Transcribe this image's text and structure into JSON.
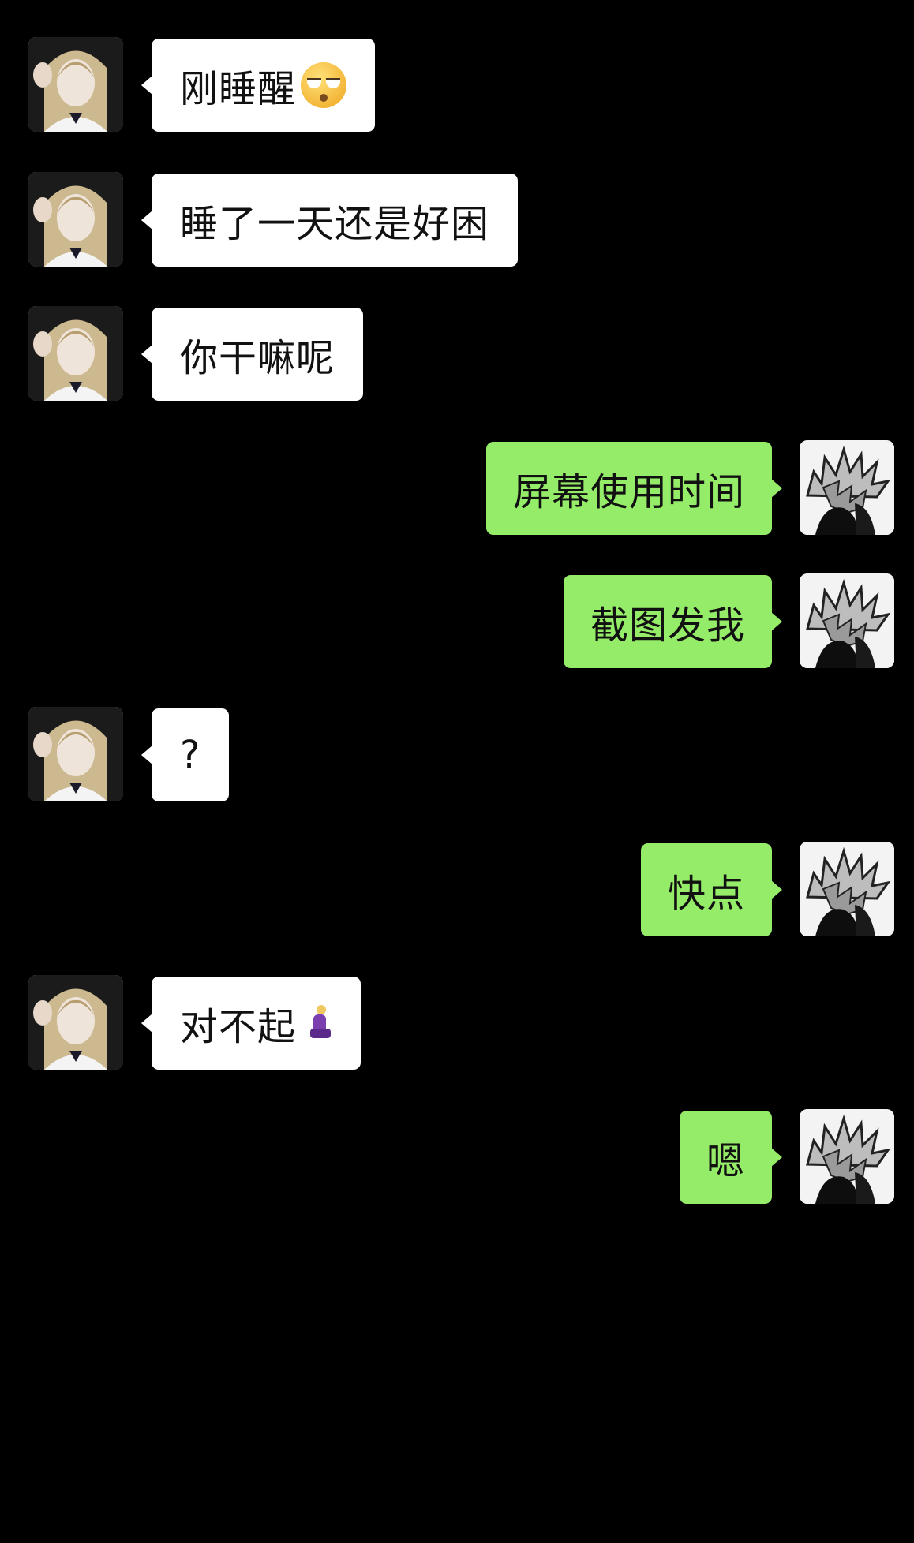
{
  "messages": [
    {
      "side": "left",
      "text": "刚睡醒",
      "emoji": "face-with-rolling-eyes-emoji"
    },
    {
      "side": "left",
      "text": "睡了一天还是好困"
    },
    {
      "side": "left",
      "text": "你干嘛呢"
    },
    {
      "side": "right",
      "text": "屏幕使用时间"
    },
    {
      "side": "right",
      "text": "截图发我"
    },
    {
      "side": "left",
      "text": "?"
    },
    {
      "side": "right",
      "text": "快点"
    },
    {
      "side": "left",
      "text": "对不起",
      "emoji": "person-kneeling-emoji"
    },
    {
      "side": "right",
      "text": "嗯"
    }
  ],
  "colors": {
    "background": "#000000",
    "incoming_bubble": "#ffffff",
    "outgoing_bubble": "#95ec69",
    "text": "#111111"
  },
  "avatars": {
    "incoming": "girl-portrait-avatar",
    "outgoing": "spiky-hair-manga-avatar"
  }
}
